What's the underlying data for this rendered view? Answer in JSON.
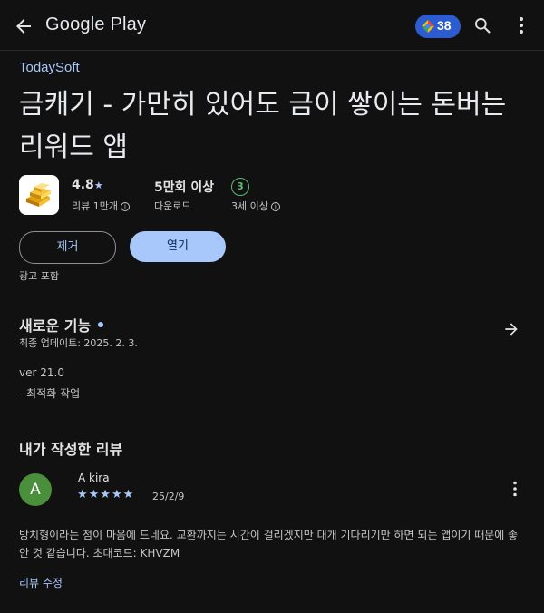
{
  "topbar": {
    "logo": "Google Play",
    "points": "38",
    "icons": [
      "back-arrow-icon",
      "play-points-icon",
      "search-icon",
      "more-vert-icon"
    ]
  },
  "app": {
    "developer": "TodaySoft",
    "title": "금캐기 - 가만히 있어도 금이 쌓이는 돈버는 리워드 앱",
    "icon": "gold-bars-icon",
    "rating": "4.8",
    "rating_star": "★",
    "reviews_label": "리뷰 1만개",
    "downloads": "5만회 이상",
    "downloads_label": "다운로드",
    "age_rating": "3",
    "age_label": "3세 이상"
  },
  "actions": {
    "uninstall": "제거",
    "open": "열기",
    "ads_notice": "광고 포함"
  },
  "whats_new": {
    "title": "새로운 기능",
    "updated": "최종 업데이트: 2025. 2. 3.",
    "version": "ver 21.0",
    "note": "- 최적화 작업"
  },
  "my_review": {
    "title": "내가 작성한 리뷰",
    "avatar_letter": "A",
    "reviewer": "A kira",
    "rating": 5,
    "stars": "★★★★★",
    "date": "25/2/9",
    "text": "방치형이라는 점이 마음에 드네요. 교환까지는 시간이 걸리겠지만 대개 기다리기만 하면 되는 앱이기 때문에 좋안 것 같습니다. 초대코드: KHVZM",
    "edit_label": "리뷰 수정"
  },
  "colors": {
    "background": "#111111",
    "accent": "#a8c7fa",
    "points_badge": "#2d5bd0",
    "age_badge": "#5bb974",
    "avatar": "#4a8f3c"
  }
}
